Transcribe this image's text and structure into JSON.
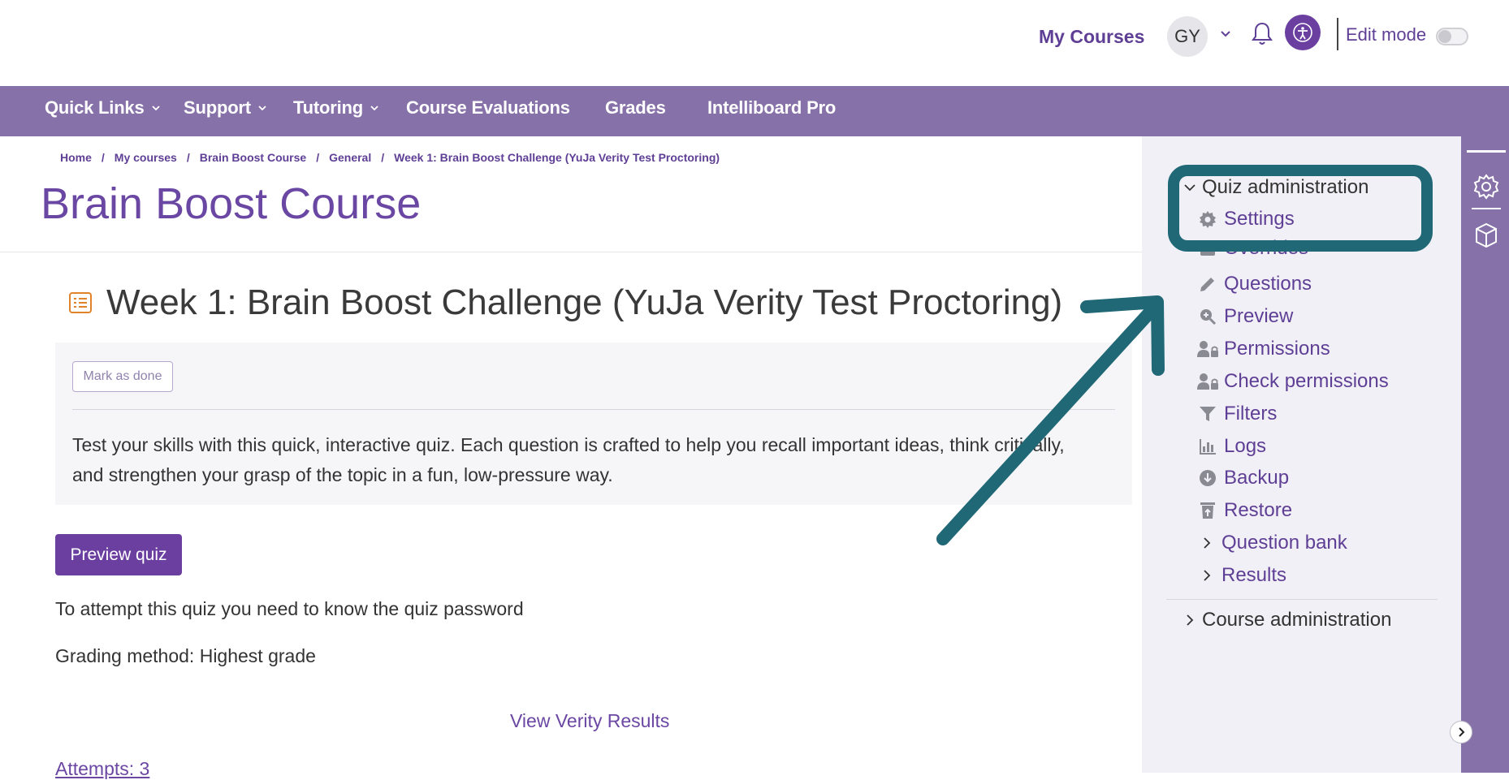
{
  "header": {
    "my_courses": "My Courses",
    "avatar_initials": "GY",
    "edit_mode_label": "Edit mode",
    "edit_mode_on": false
  },
  "nav": {
    "items": [
      {
        "label": "Quick Links",
        "dropdown": true
      },
      {
        "label": "Support",
        "dropdown": true
      },
      {
        "label": "Tutoring",
        "dropdown": true
      },
      {
        "label": "Course Evaluations",
        "dropdown": false
      },
      {
        "label": "Grades",
        "dropdown": false
      },
      {
        "label": "Intelliboard Pro",
        "dropdown": false
      }
    ]
  },
  "breadcrumb": [
    "Home",
    "My courses",
    "Brain Boost Course",
    "General",
    "Week 1: Brain Boost Challenge (YuJa Verity Test Proctoring)"
  ],
  "course_title": "Brain Boost Course",
  "quiz": {
    "title": "Week 1: Brain Boost Challenge (YuJa Verity Test Proctoring)",
    "mark_done": "Mark as done",
    "description": "Test your skills with this quick, interactive quiz. Each question is crafted to help you recall important ideas, think critically, and strengthen your grasp of the topic in a fun, low-pressure way.",
    "preview_button": "Preview quiz",
    "password_note": "To attempt this quiz you need to know the quiz password",
    "grading_method": "Grading method: Highest grade",
    "verity_link": "View Verity Results",
    "attempts": "Attempts: 3"
  },
  "drawer": {
    "quiz_admin": "Quiz administration",
    "items": [
      {
        "label": "Settings",
        "icon": "gear-icon"
      },
      {
        "label": "Overrides",
        "icon": "calendar-icon"
      },
      {
        "label": "Questions",
        "icon": "pencil-icon"
      },
      {
        "label": "Preview",
        "icon": "magnify-plus-icon"
      },
      {
        "label": "Permissions",
        "icon": "user-lock-icon"
      },
      {
        "label": "Check permissions",
        "icon": "user-lock-icon"
      },
      {
        "label": "Filters",
        "icon": "filter-icon"
      },
      {
        "label": "Logs",
        "icon": "bar-chart-icon"
      },
      {
        "label": "Backup",
        "icon": "download-circle-icon"
      },
      {
        "label": "Restore",
        "icon": "trash-upload-icon"
      }
    ],
    "sub_items": [
      {
        "label": "Question bank"
      },
      {
        "label": "Results"
      }
    ],
    "course_admin": "Course administration"
  },
  "colors": {
    "brand_purple": "#6b3fa0",
    "nav_purple": "#8771a9",
    "annotation_teal": "#216876"
  }
}
